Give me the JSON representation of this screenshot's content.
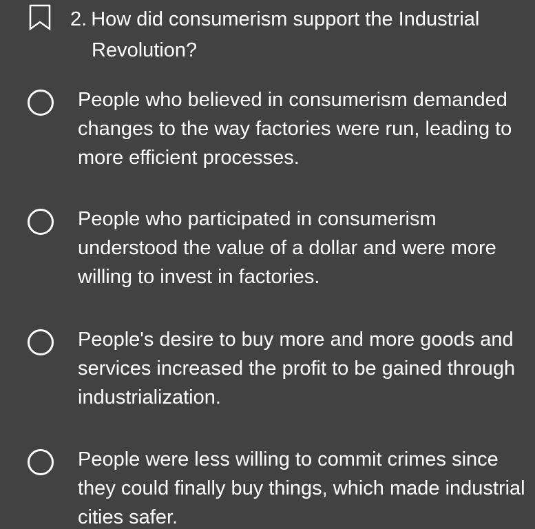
{
  "question": {
    "number": "2.",
    "line1": "How did consumerism support the Industrial",
    "line2": "Revolution?"
  },
  "options": [
    {
      "text": "People who believed in consumerism demanded changes to the way factories were run, leading to more efficient processes."
    },
    {
      "text": "People who participated in consumerism understood the value of a dollar and were more willing to invest in factories."
    },
    {
      "text": "People's desire to buy more and more goods and services increased the profit to be gained through industrialization."
    },
    {
      "text": "People were less willing to commit crimes since they could finally buy things, which made industrial cities safer."
    }
  ],
  "icons": {
    "bookmark": "bookmark-outline-icon",
    "radio": "radio-unchecked-icon"
  },
  "colors": {
    "background": "#424242",
    "text": "#ffffff"
  }
}
